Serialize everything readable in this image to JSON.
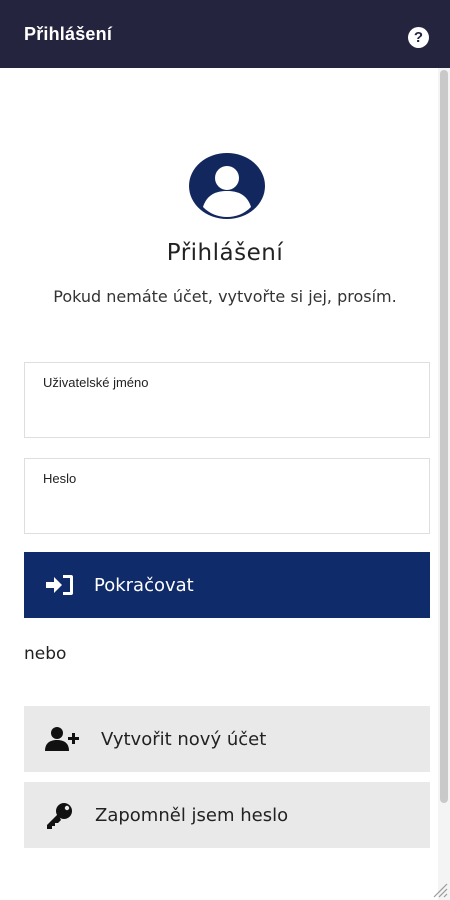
{
  "window": {
    "title": "Přihlášení",
    "help_icon": "question-circle-icon",
    "help_label": "?"
  },
  "login": {
    "avatar_icon": "user-circle-icon",
    "heading": "Přihlášení",
    "subtitle": "Pokud nemáte účet, vytvořte si jej, prosím."
  },
  "form": {
    "username": {
      "label": "Uživatelské jméno",
      "value": ""
    },
    "password": {
      "label": "Heslo",
      "value": ""
    },
    "submit": {
      "label": "Pokračovat",
      "icon": "sign-in-icon"
    }
  },
  "alternatives": {
    "separator": "nebo",
    "create_account": {
      "label": "Vytvořit nový účet",
      "icon": "user-plus-icon"
    },
    "forgot_password": {
      "label": "Zapomněl jsem heslo",
      "icon": "key-icon"
    }
  },
  "colors": {
    "titlebar": "#24243f",
    "primary": "#102b6a",
    "secondary_bg": "#e9e9e9"
  }
}
